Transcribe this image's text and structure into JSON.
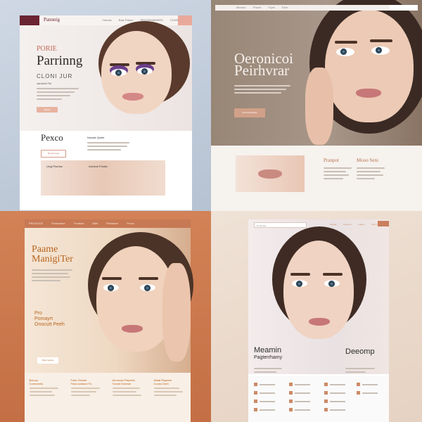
{
  "q1": {
    "logo": "Pannnig",
    "nav_links": [
      "Homes",
      "Bale Patron",
      "PROGRAMMERS",
      "CONSERR"
    ],
    "hero_small": "PORIE",
    "hero_big": "Parrinng",
    "hero_sub": "CLONI JUR",
    "hero_label": "Jancieel Tel",
    "hero_button": "Buttan",
    "lower_title": "Pexco",
    "lower_button": "Ronvet Leet",
    "lower_label": "Nouale Quiiet",
    "band_label_1": "Lingl Florrion",
    "band_label_2": "Ivorivne Fhoiec"
  },
  "q2": {
    "nav_links": [
      "Mieslen",
      "Prsent",
      "Fiyos",
      "Elrer"
    ],
    "hero_title_1": "Oeronicoi",
    "hero_title_2": "Peirhvrar",
    "hero_button": "Poverite Bluelet",
    "col1_title": "Pranpot",
    "col2_title": "Mooo Seni"
  },
  "q3": {
    "nav_links": [
      "PROGUCE",
      "Porfsonsre",
      "Trrotsee",
      "Bilet",
      "Perfatoce",
      "Prono"
    ],
    "hero_title_1": "Paame",
    "hero_title_2": "ManigiTer",
    "hero_small_1": "Pro",
    "hero_small_2": "Pomayrt",
    "hero_small_3": "Onocutt Peeh",
    "hero_button": "Ropt Aeolne",
    "cols": [
      {
        "t1": "Bomcy",
        "t2": "Comroeels"
      },
      {
        "t1": "Fche Gennie",
        "t2": "Fdocoonalom Fu"
      },
      {
        "t1": "Annocoe Plepeies",
        "t2": "Tocoie Donese"
      },
      {
        "t1": "Aliaal Rsgame",
        "t2": "Cooes Dent"
      }
    ]
  },
  "q4": {
    "search_placeholder": "Ruranaiee",
    "nav_links": [
      "Toranie",
      "Pomeron",
      "Lasens",
      "Comnnaro"
    ],
    "hero_title": "Meamin",
    "hero_subtitle": "Pagterrhamy",
    "hero_right": "Deeomp"
  }
}
